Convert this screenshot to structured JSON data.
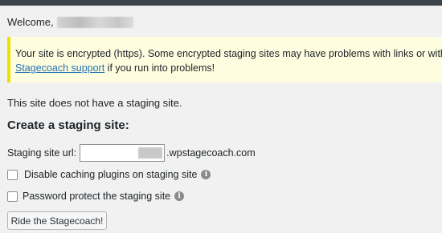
{
  "welcome": {
    "label": "Welcome,"
  },
  "notice": {
    "text": "Your site is encrypted (https). Some encrypted staging sites may have problems with links or with logging in.",
    "link_text": "Stagecoach support",
    "after_link": " if you run into problems!"
  },
  "status": {
    "no_staging": "This site does not have a staging site."
  },
  "form": {
    "heading": "Create a staging site:",
    "url_label": "Staging site url:",
    "url_suffix": ".wpstagecoach.com",
    "option_disable_caching": "Disable caching plugins on staging site",
    "option_password_protect": "Password protect the staging site",
    "submit_label": "Ride the Stagecoach!"
  },
  "colors": {
    "notice_border": "#f0e000",
    "notice_bg": "#fffde0",
    "link": "#2271b1"
  },
  "icons": {
    "info": "info-icon"
  }
}
